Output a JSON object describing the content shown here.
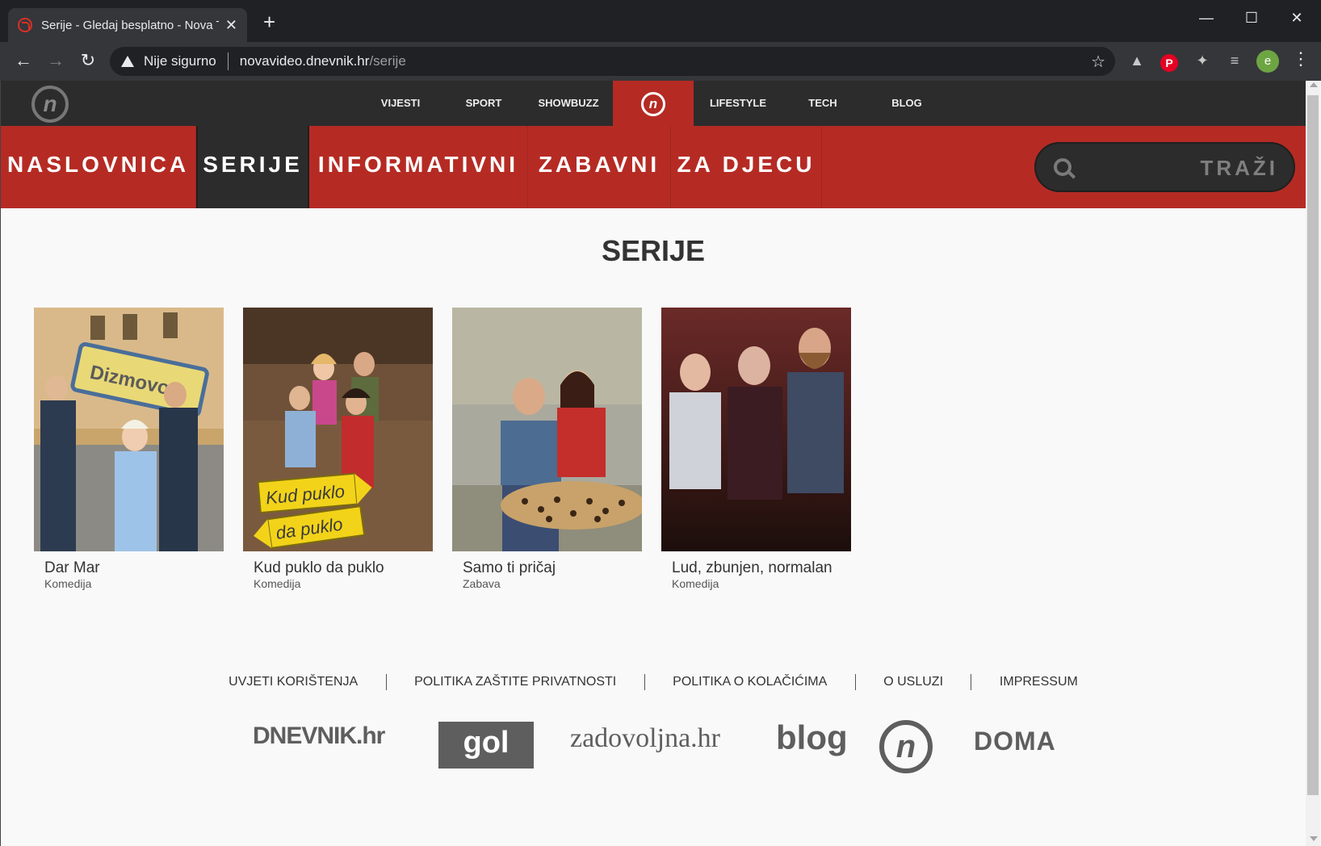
{
  "browser": {
    "tab_title": "Serije - Gledaj besplatno - Nova TV",
    "security_label": "Nije sigurno",
    "url_host": "novavideo.dnevnik.hr",
    "url_path": "/serije",
    "avatar_letter": "e",
    "icons": {
      "back": "←",
      "forward": "→",
      "reload": "↻",
      "star": "☆",
      "minimize": "—",
      "maximize": "☐",
      "close": "✕",
      "new_tab": "+",
      "tab_close": "✕",
      "menu": "⋮",
      "ext_pinterest": "P",
      "ext_puzzle": "✦",
      "ext_media": "≡",
      "ext_other": "▲"
    }
  },
  "topnav": {
    "logo_letter": "n",
    "links": [
      "VIJESTI",
      "SPORT",
      "SHOWBUZZ",
      "LIFESTYLE",
      "TECH",
      "BLOG"
    ]
  },
  "mainnav": {
    "items": [
      "NASLOVNICA",
      "SERIJE",
      "INFORMATIVNI",
      "ZABAVNI",
      "ZA DJECU"
    ],
    "active": "SERIJE",
    "search_placeholder": "TRAŽI"
  },
  "page": {
    "title": "SERIJE"
  },
  "shows": [
    {
      "title": "Dar Mar",
      "genre": "Komedija",
      "sign_text": "Dizmovo"
    },
    {
      "title": "Kud puklo da puklo",
      "genre": "Komedija",
      "sign_text": "Kud puklo",
      "sign_text2": "da puklo"
    },
    {
      "title": "Samo ti pričaj",
      "genre": "Zabava"
    },
    {
      "title": "Lud, zbunjen, normalan",
      "genre": "Komedija"
    }
  ],
  "footer": {
    "links": [
      "UVJETI KORIŠTENJA",
      "POLITIKA ZAŠTITE PRIVATNOSTI",
      "POLITIKA O KOLAČIĆIMA",
      "O USLUZI",
      "IMPRESSUM"
    ],
    "logos": [
      "DNEVNIK.hr",
      "gol",
      "zadovoljna.hr",
      "blog",
      "n",
      "DOMA"
    ]
  },
  "colors": {
    "brand_red": "#b52b24",
    "dark": "#2c2c2c"
  }
}
